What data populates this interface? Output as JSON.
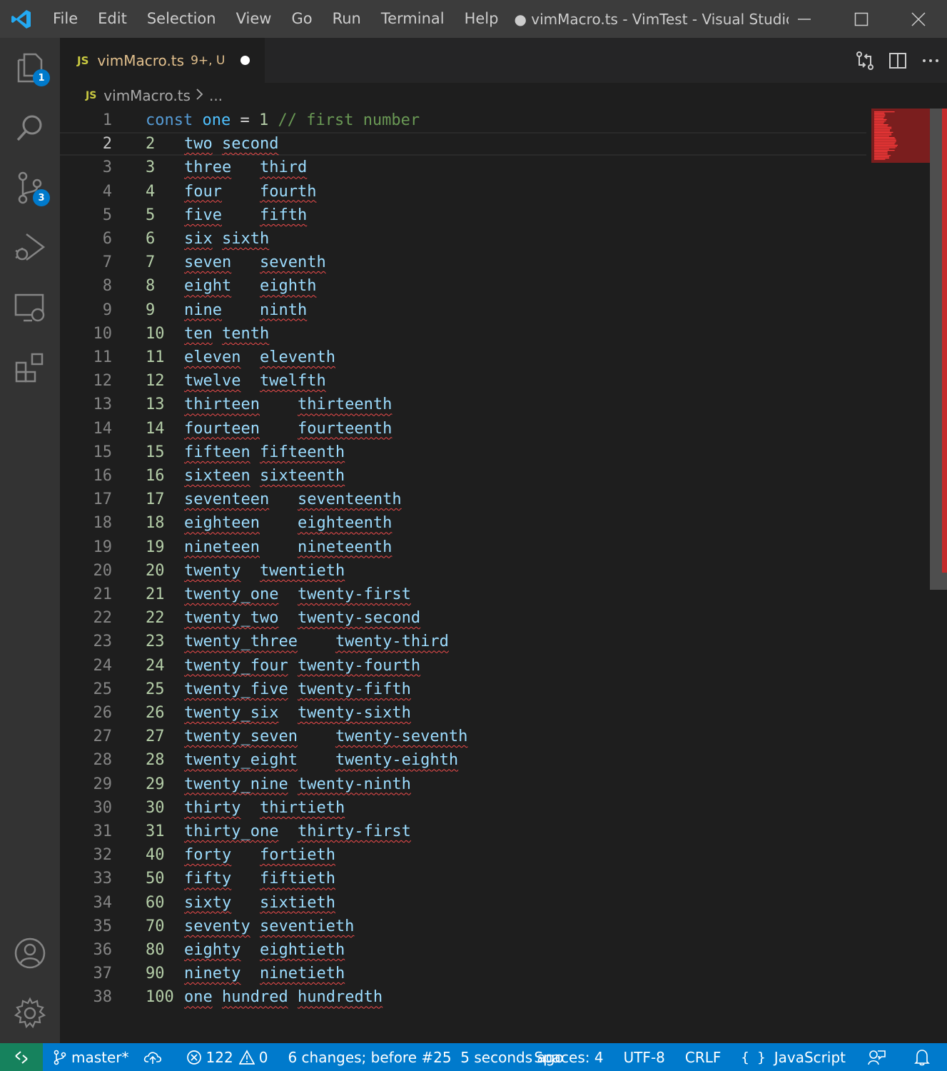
{
  "titlebar": {
    "menu": [
      "File",
      "Edit",
      "Selection",
      "View",
      "Go",
      "Run",
      "Terminal",
      "Help"
    ],
    "window_title": "● vimMacro.ts - VimTest - Visual Studio..."
  },
  "activity": {
    "explorer_badge": "1",
    "scm_badge": "3"
  },
  "tab": {
    "lang_badge": "JS",
    "filename": "vimMacro.ts",
    "status": "9+, U"
  },
  "breadcrumb": {
    "lang_badge": "JS",
    "file": "vimMacro.ts",
    "more": "..."
  },
  "editor": {
    "current_line": 2,
    "lines": [
      {
        "n": "1",
        "num": "const",
        "a": "one",
        "b": "= 1 // first number"
      },
      {
        "n": "2",
        "num": "2",
        "a": "two",
        "b": "second",
        "gap": " "
      },
      {
        "n": "3",
        "num": "3",
        "a": "three",
        "b": "third",
        "gap": "   "
      },
      {
        "n": "4",
        "num": "4",
        "a": "four",
        "b": "fourth",
        "gap": "    "
      },
      {
        "n": "5",
        "num": "5",
        "a": "five",
        "b": "fifth",
        "gap": "    "
      },
      {
        "n": "6",
        "num": "6",
        "a": "six",
        "b": "sixth",
        "gap": " "
      },
      {
        "n": "7",
        "num": "7",
        "a": "seven",
        "b": "seventh",
        "gap": "   "
      },
      {
        "n": "8",
        "num": "8",
        "a": "eight",
        "b": "eighth",
        "gap": "   "
      },
      {
        "n": "9",
        "num": "9",
        "a": "nine",
        "b": "ninth",
        "gap": "    "
      },
      {
        "n": "10",
        "num": "10",
        "a": "ten",
        "b": "tenth",
        "gap": " "
      },
      {
        "n": "11",
        "num": "11",
        "a": "eleven",
        "b": "eleventh",
        "gap": "  "
      },
      {
        "n": "12",
        "num": "12",
        "a": "twelve",
        "b": "twelfth",
        "gap": "  "
      },
      {
        "n": "13",
        "num": "13",
        "a": "thirteen",
        "b": "thirteenth",
        "gap": "    "
      },
      {
        "n": "14",
        "num": "14",
        "a": "fourteen",
        "b": "fourteenth",
        "gap": "    "
      },
      {
        "n": "15",
        "num": "15",
        "a": "fifteen",
        "b": "fifteenth",
        "gap": " "
      },
      {
        "n": "16",
        "num": "16",
        "a": "sixteen",
        "b": "sixteenth",
        "gap": " "
      },
      {
        "n": "17",
        "num": "17",
        "a": "seventeen",
        "b": "seventeenth",
        "gap": "   "
      },
      {
        "n": "18",
        "num": "18",
        "a": "eighteen",
        "b": "eighteenth",
        "gap": "    "
      },
      {
        "n": "19",
        "num": "19",
        "a": "nineteen",
        "b": "nineteenth",
        "gap": "    "
      },
      {
        "n": "20",
        "num": "20",
        "a": "twenty",
        "b": "twentieth",
        "gap": "  "
      },
      {
        "n": "21",
        "num": "21",
        "a": "twenty_one",
        "b": "twenty-first",
        "gap": "  "
      },
      {
        "n": "22",
        "num": "22",
        "a": "twenty_two",
        "b": "twenty-second",
        "gap": "  "
      },
      {
        "n": "23",
        "num": "23",
        "a": "twenty_three",
        "b": "twenty-third",
        "gap": "    "
      },
      {
        "n": "24",
        "num": "24",
        "a": "twenty_four",
        "b": "twenty-fourth",
        "gap": " "
      },
      {
        "n": "25",
        "num": "25",
        "a": "twenty_five",
        "b": "twenty-fifth",
        "gap": " "
      },
      {
        "n": "26",
        "num": "26",
        "a": "twenty_six",
        "b": "twenty-sixth",
        "gap": "  "
      },
      {
        "n": "27",
        "num": "27",
        "a": "twenty_seven",
        "b": "twenty-seventh",
        "gap": "    "
      },
      {
        "n": "28",
        "num": "28",
        "a": "twenty_eight",
        "b": "twenty-eighth",
        "gap": "    "
      },
      {
        "n": "29",
        "num": "29",
        "a": "twenty_nine",
        "b": "twenty-ninth",
        "gap": " "
      },
      {
        "n": "30",
        "num": "30",
        "a": "thirty",
        "b": "thirtieth",
        "gap": "  "
      },
      {
        "n": "31",
        "num": "31",
        "a": "thirty_one",
        "b": "thirty-first",
        "gap": "  "
      },
      {
        "n": "32",
        "num": "40",
        "a": "forty",
        "b": "fortieth",
        "gap": "   "
      },
      {
        "n": "33",
        "num": "50",
        "a": "fifty",
        "b": "fiftieth",
        "gap": "   "
      },
      {
        "n": "34",
        "num": "60",
        "a": "sixty",
        "b": "sixtieth",
        "gap": "   "
      },
      {
        "n": "35",
        "num": "70",
        "a": "seventy",
        "b": "seventieth",
        "gap": " "
      },
      {
        "n": "36",
        "num": "80",
        "a": "eighty",
        "b": "eightieth",
        "gap": "  "
      },
      {
        "n": "37",
        "num": "90",
        "a": "ninety",
        "b": "ninetieth",
        "gap": "  "
      },
      {
        "n": "38",
        "num": "100",
        "a": "one",
        "b": "hundred",
        "c": "hundredth",
        "gap": " "
      }
    ]
  },
  "statusbar": {
    "branch": "master*",
    "errors": "122",
    "warnings": "0",
    "undo_info": "6 changes; before #25  5 seconds ago",
    "spaces": "Spaces: 4",
    "encoding": "UTF-8",
    "eol": "CRLF",
    "language": "JavaScript"
  },
  "colors": {
    "accent": "#007acc",
    "remote": "#16825d",
    "error_squiggle": "#f14c4c"
  }
}
